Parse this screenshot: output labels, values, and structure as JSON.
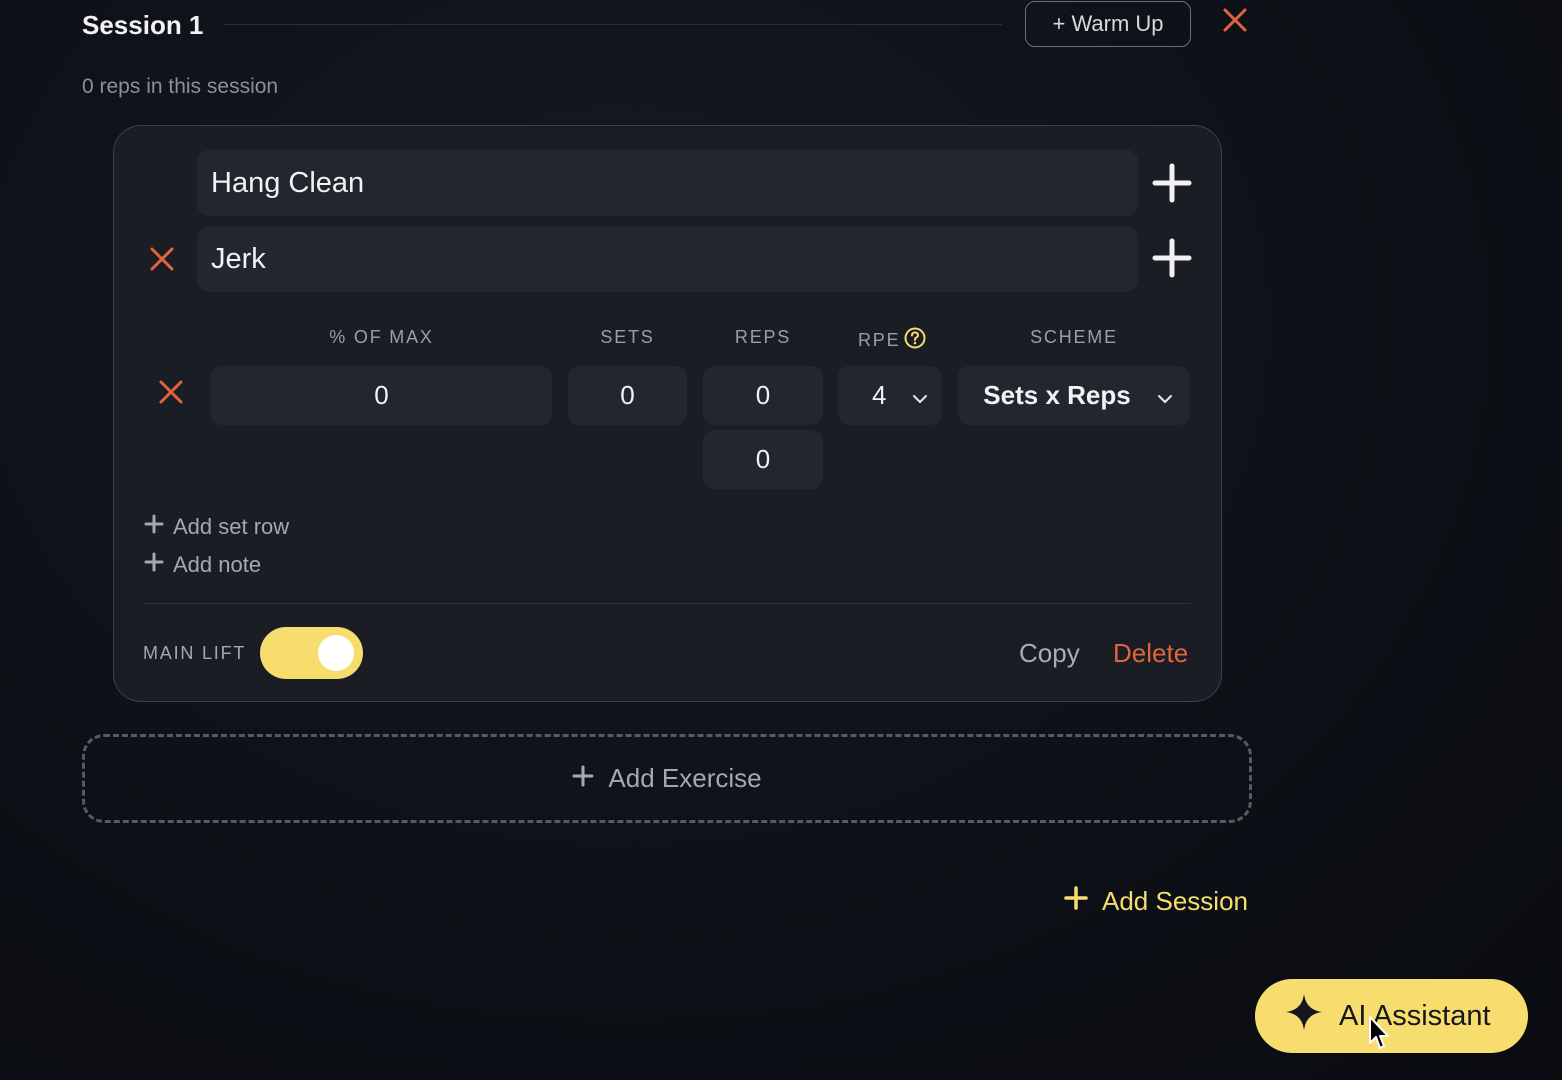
{
  "session": {
    "title": "Session 1",
    "subtitle": "0 reps in this session",
    "warmup_label": "+ Warm Up"
  },
  "exercise": {
    "names": [
      "Hang Clean",
      "Jerk"
    ],
    "columns": {
      "pct_max": "% OF MAX",
      "sets": "SETS",
      "reps": "REPS",
      "rpe": "RPE",
      "scheme": "SCHEME"
    },
    "row": {
      "pct_max": "0",
      "sets": "0",
      "reps": [
        "0",
        "0"
      ],
      "rpe": "4",
      "scheme": "Sets x Reps"
    },
    "add_set_row": "Add set row",
    "add_note": "Add note",
    "main_lift_label": "MAIN LIFT",
    "main_lift_on": true,
    "copy_label": "Copy",
    "delete_label": "Delete"
  },
  "add_exercise_label": "Add Exercise",
  "add_session_label": "Add Session",
  "ai_assistant_label": "AI Assistant",
  "colors": {
    "accent": "#f7dd6e",
    "danger": "#e0643c",
    "background": "#0e1117",
    "card": "#1a1d24",
    "field": "#22262e"
  }
}
